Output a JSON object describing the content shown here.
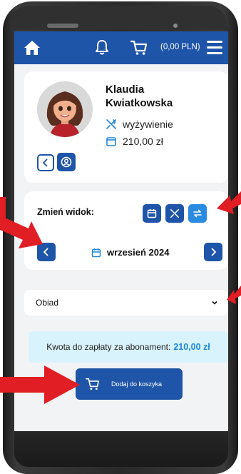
{
  "header": {
    "cart_amount": "(0,00 PLN)",
    "icons": [
      "home-icon",
      "bell-icon",
      "cart-icon",
      "hamburger-menu-icon"
    ]
  },
  "profile": {
    "first_name": "Klaudia",
    "last_name": "Kwiatkowska",
    "meal_plan": "wyżywienie",
    "balance": "210,00 zł"
  },
  "view_switch": {
    "label": "Zmień widok:",
    "month": "wrzesień 2024"
  },
  "meal_select": {
    "selected": "Obiad"
  },
  "payment": {
    "label": "Kwota do zapłaty za abonament:",
    "amount": "210,00 zł"
  },
  "cart_button": {
    "label": "Dodaj do koszyka"
  },
  "colors": {
    "primary": "#1f55a8",
    "accent_light": "#2a8be0",
    "pay_bg": "#d8f3fb",
    "pay_amount": "#1f88d8",
    "arrow": "#e01e24"
  }
}
